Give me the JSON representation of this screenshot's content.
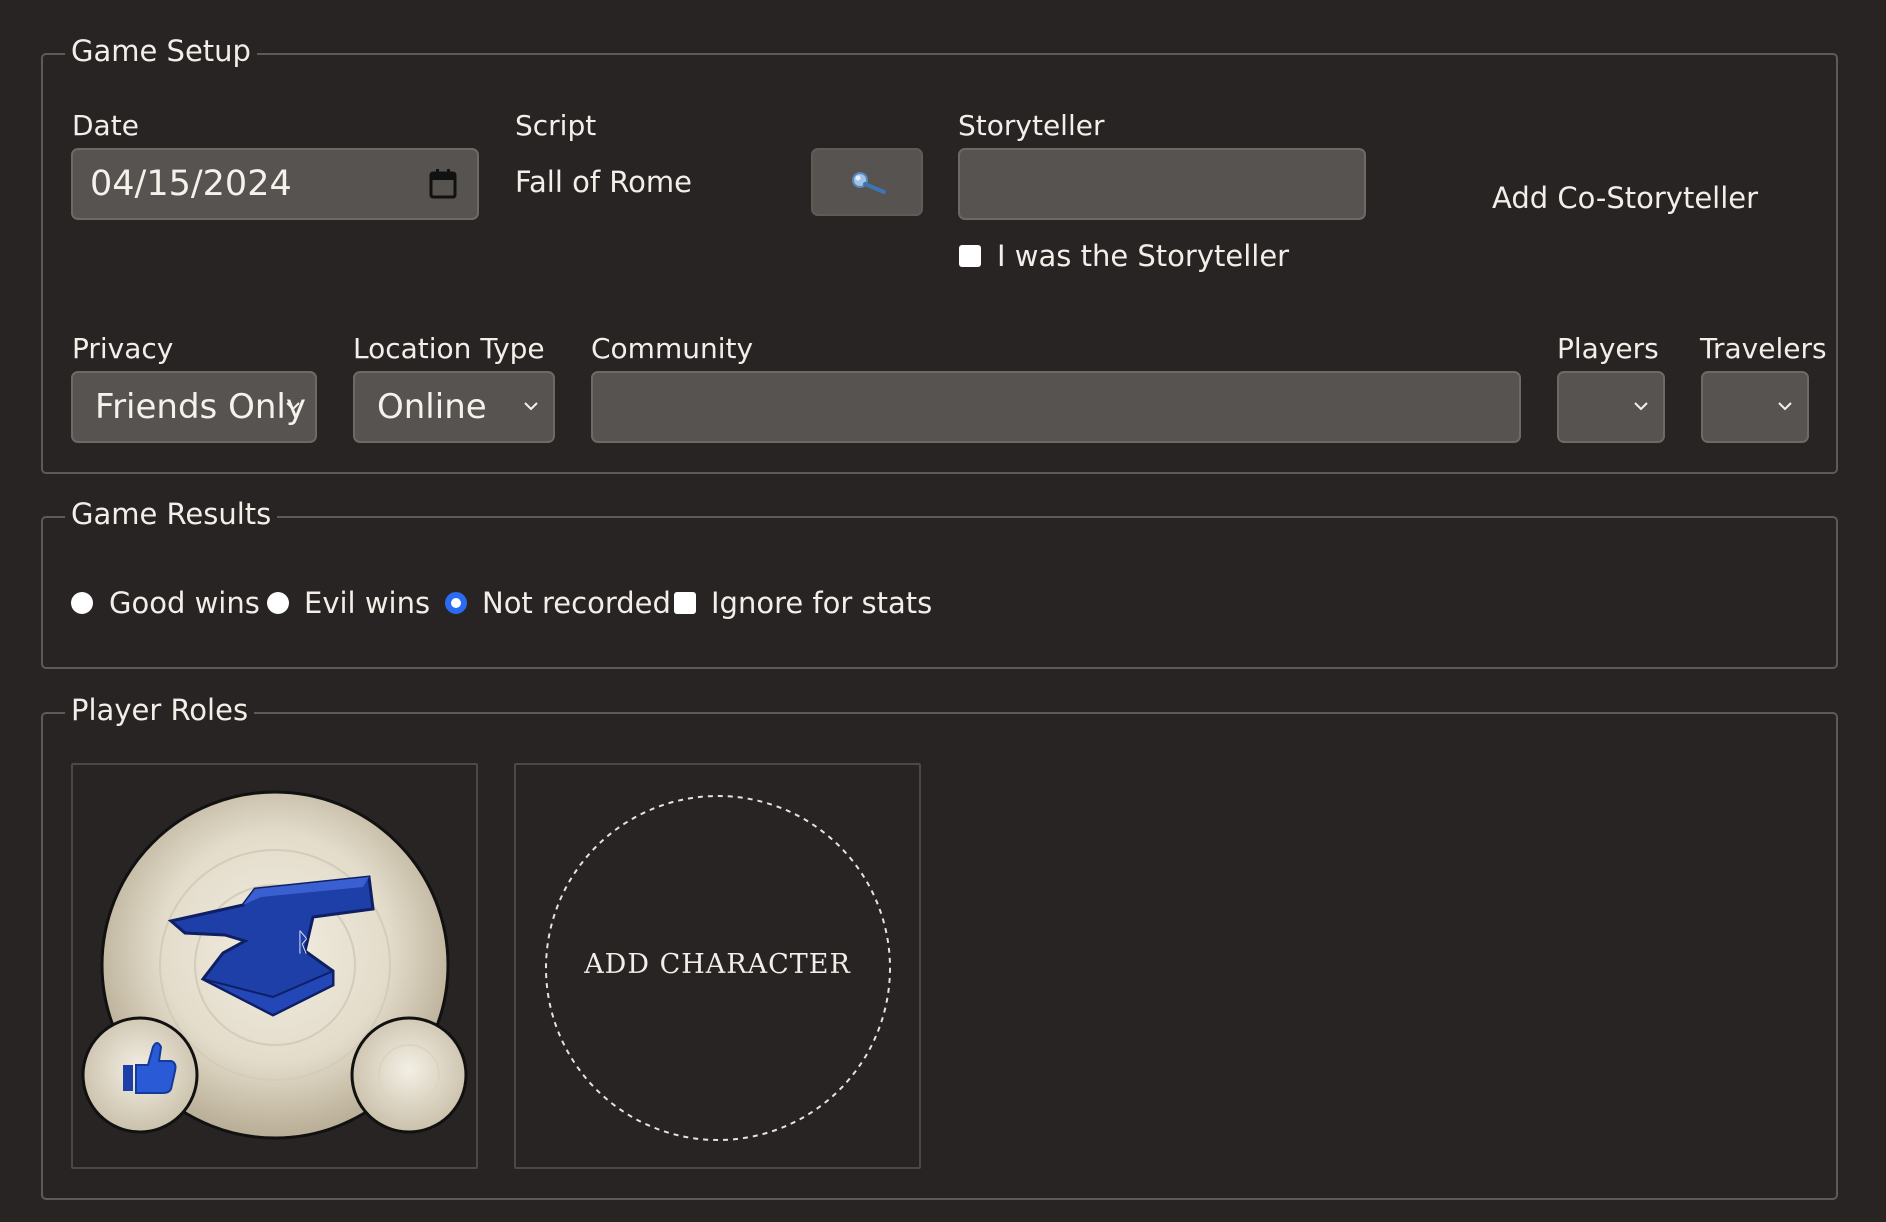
{
  "game_setup": {
    "legend": "Game Setup",
    "date": {
      "label": "Date",
      "value": "04/15/2024"
    },
    "script": {
      "label": "Script",
      "value": "Fall of Rome",
      "search_icon": "search-icon"
    },
    "storyteller": {
      "label": "Storyteller",
      "value": "",
      "checkbox_label": "I was the Storyteller",
      "checked": false
    },
    "add_co_storyteller": "Add Co-Storyteller",
    "privacy": {
      "label": "Privacy",
      "value": "Friends Only"
    },
    "location_type": {
      "label": "Location Type",
      "value": "Online"
    },
    "community": {
      "label": "Community",
      "value": ""
    },
    "players": {
      "label": "Players",
      "value": ""
    },
    "travelers": {
      "label": "Travelers",
      "value": ""
    }
  },
  "game_results": {
    "legend": "Game Results",
    "options": [
      "Good wins",
      "Evil wins",
      "Not recorded"
    ],
    "selected": "Not recorded",
    "ignore_label": "Ignore for stats",
    "ignore_checked": false
  },
  "player_roles": {
    "legend": "Player Roles",
    "cards": [
      {
        "role_icon": "anvil-icon",
        "alignment_icon": "thumbs-up-icon"
      }
    ],
    "add_character_label": "ADD CHARACTER"
  },
  "colors": {
    "background": "#272423",
    "input": "#565350",
    "accent": "#2a6bf2",
    "role_blue": "#1f3fa8"
  }
}
